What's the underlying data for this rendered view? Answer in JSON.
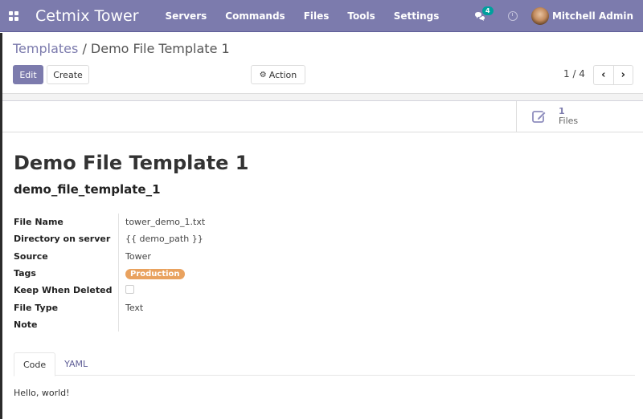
{
  "navbar": {
    "brand": "Cetmix Tower",
    "menu": [
      "Servers",
      "Commands",
      "Files",
      "Tools",
      "Settings"
    ],
    "messages_count": "4",
    "user_name": "Mitchell Admin",
    "accent_color": "#7c7bad"
  },
  "breadcrumb": {
    "parent": "Templates",
    "separator": "/",
    "current": "Demo File Template 1"
  },
  "toolbar": {
    "edit_label": "Edit",
    "create_label": "Create",
    "action_label": "Action",
    "pager_value": "1 / 4",
    "prev_icon": "chevron-left-icon",
    "next_icon": "chevron-right-icon"
  },
  "smart_button": {
    "count": "1",
    "label": "Files",
    "icon": "edit-icon"
  },
  "record": {
    "title": "Demo File Template 1",
    "reference": "demo_file_template_1",
    "fields": [
      {
        "label": "File Name",
        "value": "tower_demo_1.txt"
      },
      {
        "label": "Directory on server",
        "value": "{{ demo_path }}"
      },
      {
        "label": "Source",
        "value": "Tower"
      },
      {
        "label": "Tags",
        "value": "Production"
      },
      {
        "label": "Keep When Deleted",
        "value": ""
      },
      {
        "label": "File Type",
        "value": "Text"
      },
      {
        "label": "Note",
        "value": ""
      }
    ],
    "keep_when_deleted": false,
    "tag_color": "#e9a25f"
  },
  "tabs": {
    "items": [
      "Code",
      "YAML"
    ],
    "active": "Code",
    "content": "Hello, world!"
  }
}
